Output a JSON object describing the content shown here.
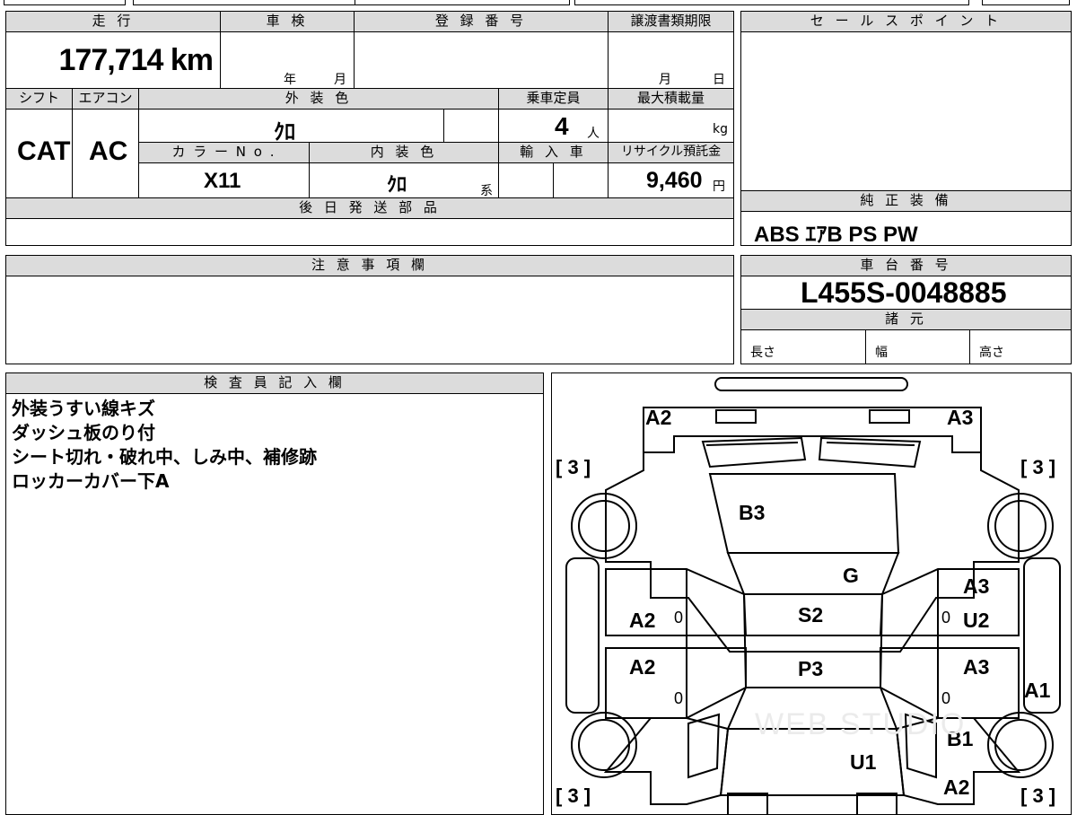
{
  "header": {
    "mileage_label": "走 行",
    "shaken_label": "車 検",
    "reg_label": "登 録 番 号",
    "transfer_label": "譲渡書類期限",
    "sales_label": "セ ー ル ス ポ イ ン ト"
  },
  "row1": {
    "mileage": "177,714 km",
    "shaken_year": "年",
    "shaken_month": "月",
    "transfer_month": "月",
    "transfer_day": "日"
  },
  "row2_labels": {
    "shift": "シフト",
    "ac": "エアコン",
    "exterior": "外 装 色",
    "capacity": "乗車定員",
    "max_load": "最大積載量"
  },
  "row2": {
    "shift": "CAT",
    "ac": "AC",
    "exterior": "ｸﾛ",
    "capacity": "4",
    "capacity_unit": "人",
    "max_load_unit": "kg"
  },
  "row3_labels": {
    "color_no": "カ ラ ー N o .",
    "interior": "内 装 色",
    "import": "輸 入 車",
    "recycle": "リサイクル預託金"
  },
  "row3": {
    "color_no": "X11",
    "interior": "ｸﾛ",
    "interior_suffix": "系",
    "recycle": "9,460",
    "recycle_unit": "円"
  },
  "later_parts_label": "後 日 発 送 部 品",
  "equipment": {
    "label": "純 正 装 備",
    "value": "ABS ｴｱB PS PW"
  },
  "notice_label": "注 意 事 項 欄",
  "chassis": {
    "label": "車 台 番 号",
    "value": "L455S-0048885",
    "spec_label": "諸 元",
    "length": "長さ",
    "width": "幅",
    "height": "高さ"
  },
  "inspector": {
    "label": "検 査 員 記 入 欄",
    "lines": [
      "外装うすい線キズ",
      "ダッシュ板のり付",
      "シート切れ・破れ中、しみ中、補修跡",
      "ロッカーカバー下A"
    ]
  },
  "diagram": {
    "marks": {
      "front_left": "A2",
      "front_right": "A3",
      "hood": "B3",
      "windshield": "G",
      "left_front_door": "A2",
      "left_rear_door": "A2",
      "right_front_door_1": "A3",
      "right_front_door_2": "U2",
      "right_rear_door": "A3",
      "roof_front": "S2",
      "roof_rear": "P3",
      "right_rocker": "A1",
      "right_rear_fender": "B1",
      "rear": "U1",
      "rear_right_corner": "A2"
    },
    "zero": "0",
    "tire": "[ 3 ]",
    "watermark": "WEB STUDIO"
  }
}
